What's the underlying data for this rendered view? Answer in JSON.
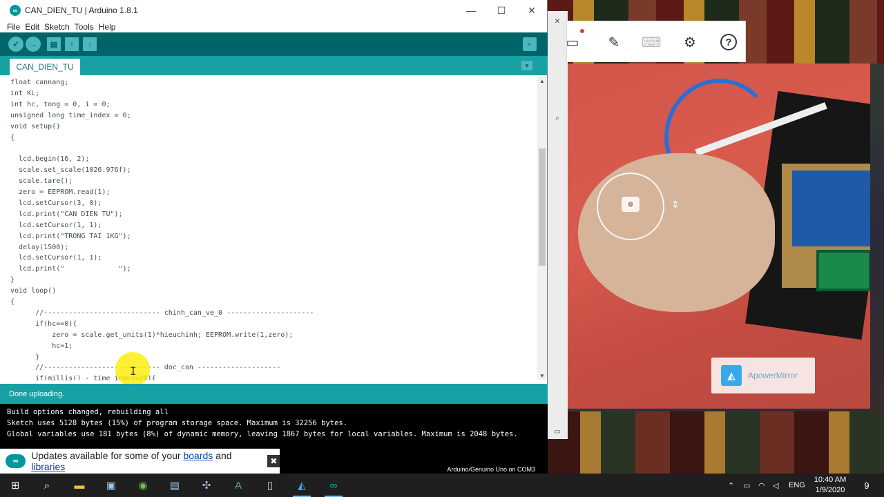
{
  "window": {
    "title": "CAN_DIEN_TU | Arduino 1.8.1",
    "icon": "arduino-icon",
    "controls": [
      "—",
      "☐",
      "✕"
    ]
  },
  "menu": [
    "File",
    "Edit",
    "Sketch",
    "Tools",
    "Help"
  ],
  "toolbar": {
    "verify": "✓",
    "upload": "→",
    "new": "▤",
    "open": "↑",
    "save": "↓",
    "serial_monitor": "⌕"
  },
  "tab": {
    "label": "CAN_DIEN_TU",
    "menu": "▼"
  },
  "code": [
    "float cannang;",
    "int KL;",
    "int hc, tong = 0, i = 0;",
    "unsigned long time_index = 0;",
    "void setup()",
    "{",
    "",
    "  lcd.begin(16, 2);",
    "  scale.set_scale(1026.976f);",
    "  scale.tare();",
    "  zero = EEPROM.read(1);",
    "  lcd.setCursor(3, 0);",
    "  lcd.print(\"CAN DIEN TU\");",
    "  lcd.setCursor(1, 1);",
    "  lcd.print(\"TRONG TAI 1KG\");",
    "  delay(1500);",
    "  lcd.setCursor(1, 1);",
    "  lcd.print(\"             \");",
    "}",
    "void loop()",
    "{",
    "      //---------------------------- chinh_can_ve_0 ---------------------",
    "      if(hc==0){",
    "          zero = scale.get_units(1)*hieuchinh; EEPROM.write(1,zero);",
    "          hc=1;",
    "      }",
    "      //---------------------------- doc_can --------------------",
    "      if(millis() - time_index>20){"
  ],
  "status": {
    "message": "Done uploading."
  },
  "console": {
    "lines": [
      "Build options changed, rebuilding all",
      "Sketch uses 5128 bytes (15%) of program storage space. Maximum is 32256 bytes.",
      "Global variables use 181 bytes (8%) of dynamic memory, leaving 1867 bytes for local variables. Maximum is 2048 bytes."
    ],
    "board": "Arduino/Genuino Uno on COM3"
  },
  "notification": {
    "prefix": "Updates available for some of your ",
    "link1": "boards",
    "middle": " and ",
    "link2": "libraries",
    "close": "✖"
  },
  "mirror": {
    "watermark": "ApowerMirror",
    "toolbar_icons": [
      "screen-cast-icon",
      "brush-icon",
      "keyboard-icon",
      "gear-icon",
      "help-icon"
    ],
    "help": "?"
  },
  "taskbar": {
    "language": "ENG",
    "time": "10:40 AM",
    "date": "1/9/2020",
    "notifications": "9"
  }
}
